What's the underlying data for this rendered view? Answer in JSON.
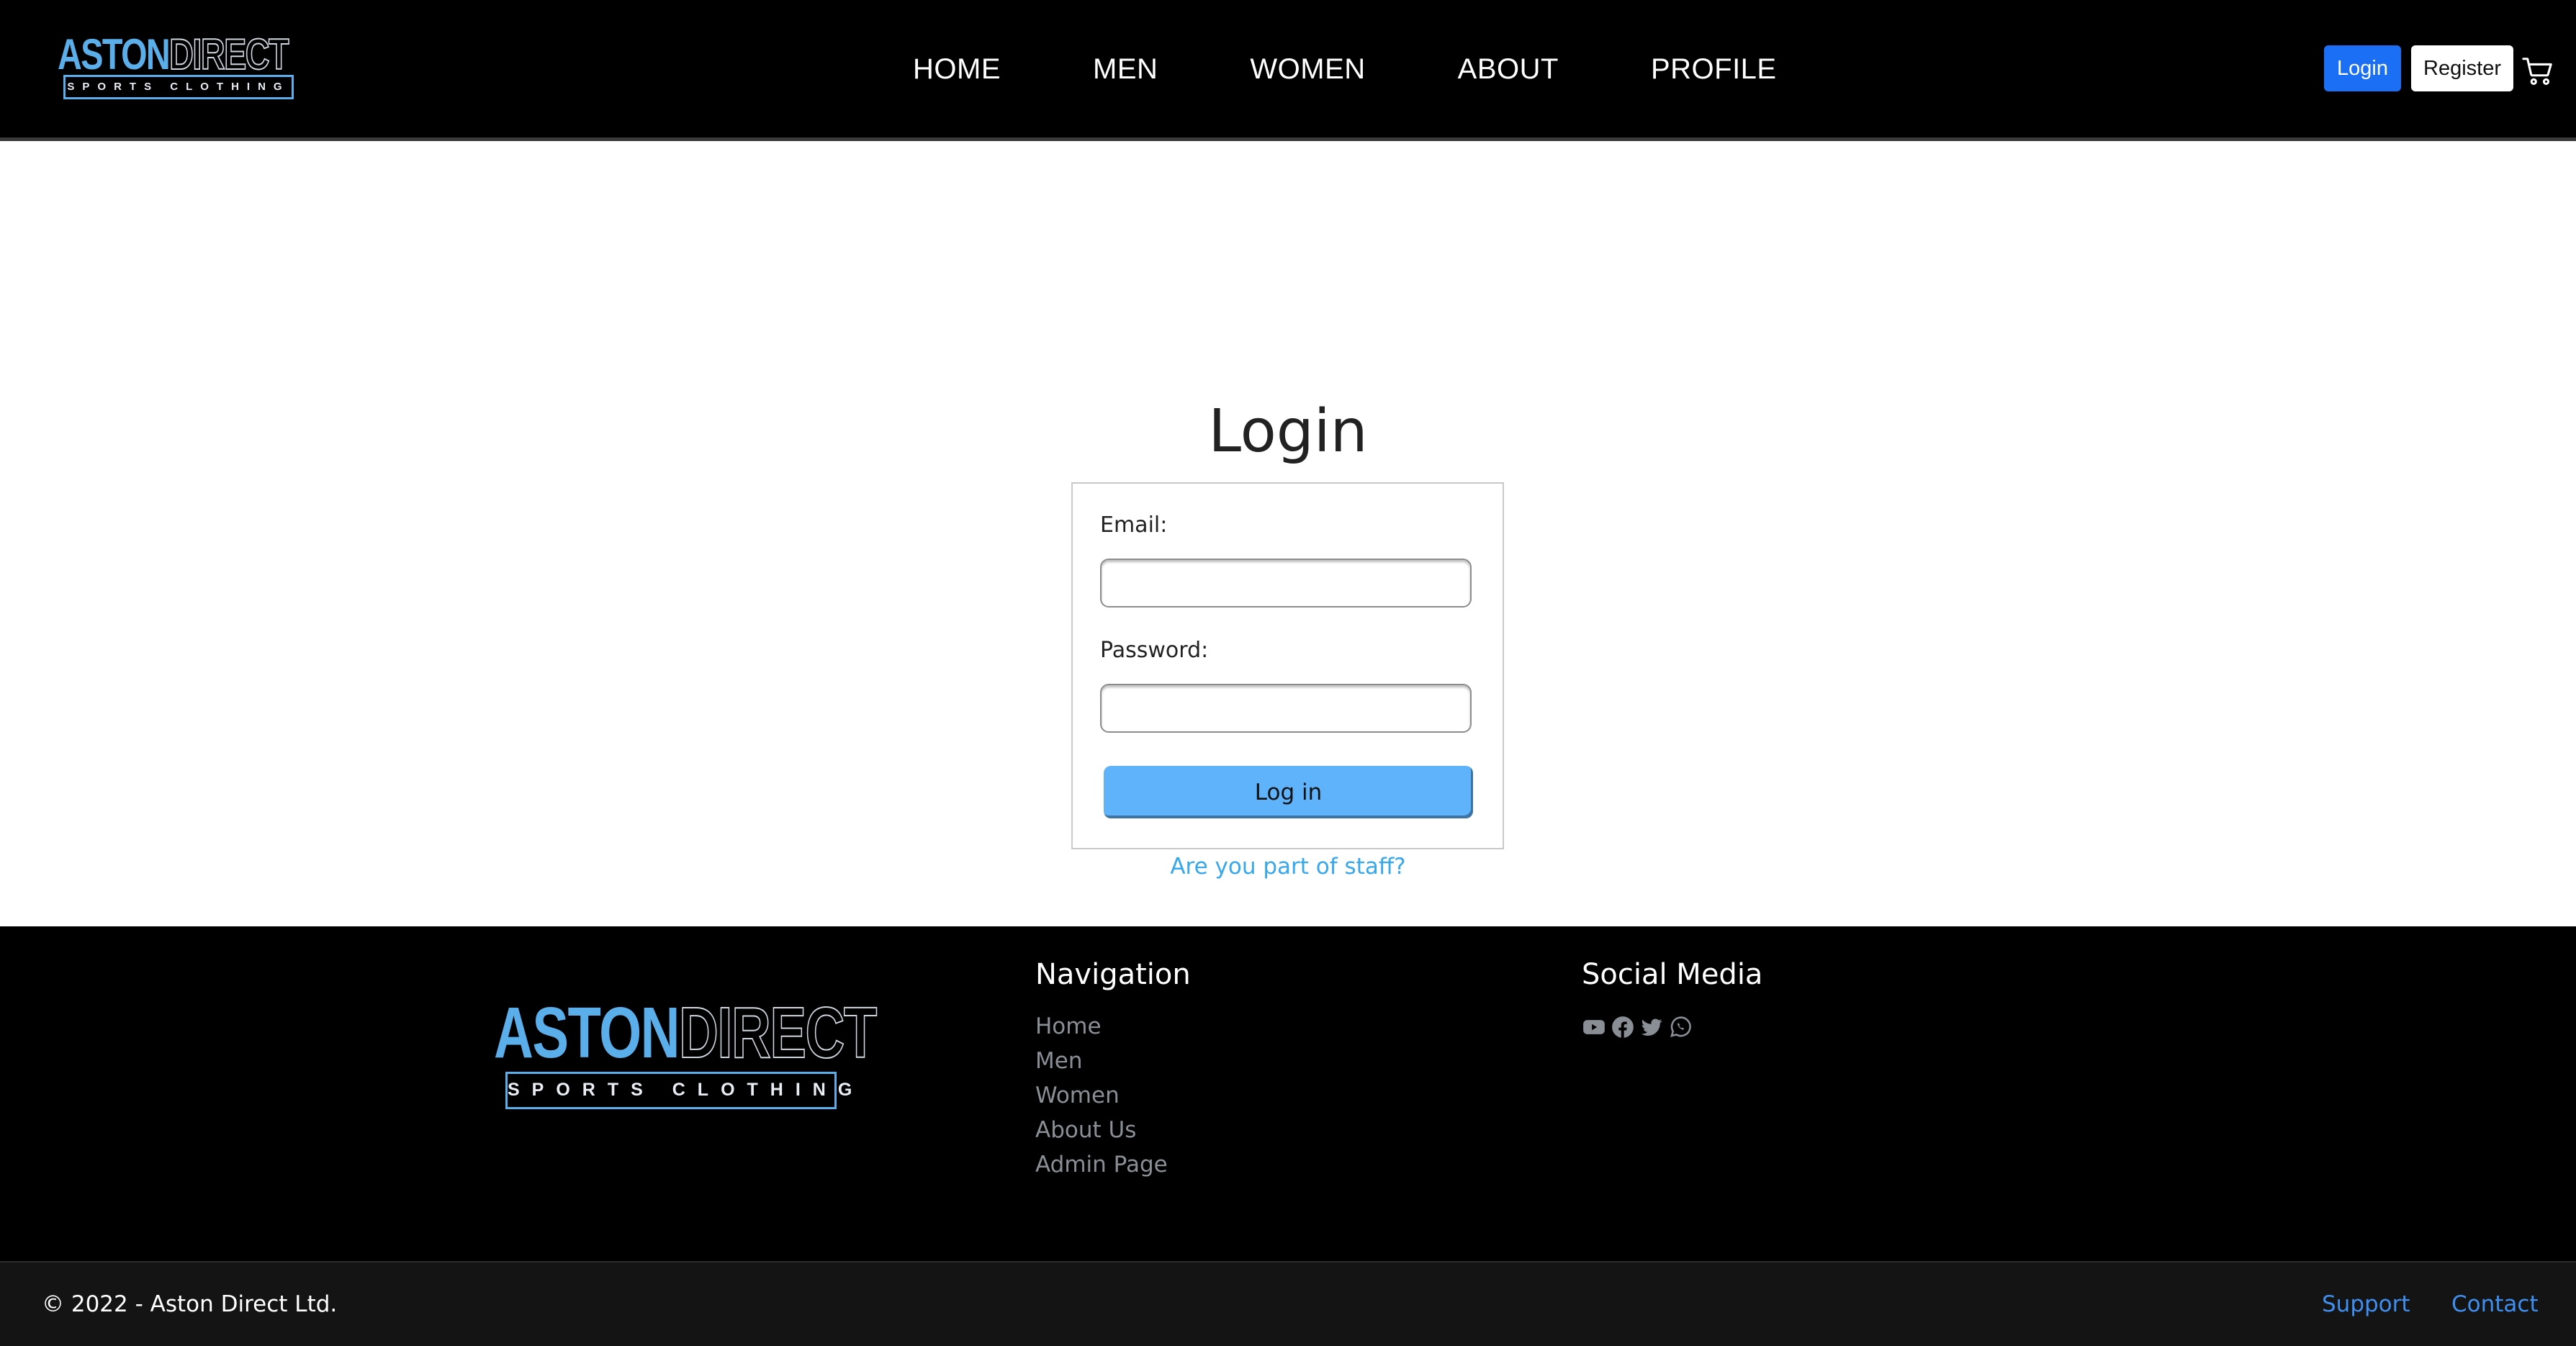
{
  "brand": {
    "name_part1": "ASTON",
    "name_part2": "DIRECT",
    "tagline": "SPORTS CLOTHING",
    "accent_color": "#5aaeea"
  },
  "header": {
    "nav": [
      "HOME",
      "MEN",
      "WOMEN",
      "ABOUT",
      "PROFILE"
    ],
    "login_label": "Login",
    "register_label": "Register",
    "cart_icon": "cart-icon",
    "login_button_color": "#1b6ff5"
  },
  "login": {
    "title": "Login",
    "email_label": "Email:",
    "email_value": "",
    "password_label": "Password:",
    "password_value": "",
    "submit_label": "Log in",
    "submit_color": "#5fb3fb",
    "staff_link": "Are you part of staff?"
  },
  "footer": {
    "nav_title": "Navigation",
    "nav_links": [
      "Home",
      "Men",
      "Women",
      "About Us",
      "Admin Page"
    ],
    "social_title": "Social Media",
    "social_icons": [
      "youtube-icon",
      "facebook-icon",
      "twitter-icon",
      "whatsapp-icon"
    ],
    "copyright": "© 2022 - Aston Direct Ltd.",
    "support_label": "Support",
    "contact_label": "Contact"
  }
}
